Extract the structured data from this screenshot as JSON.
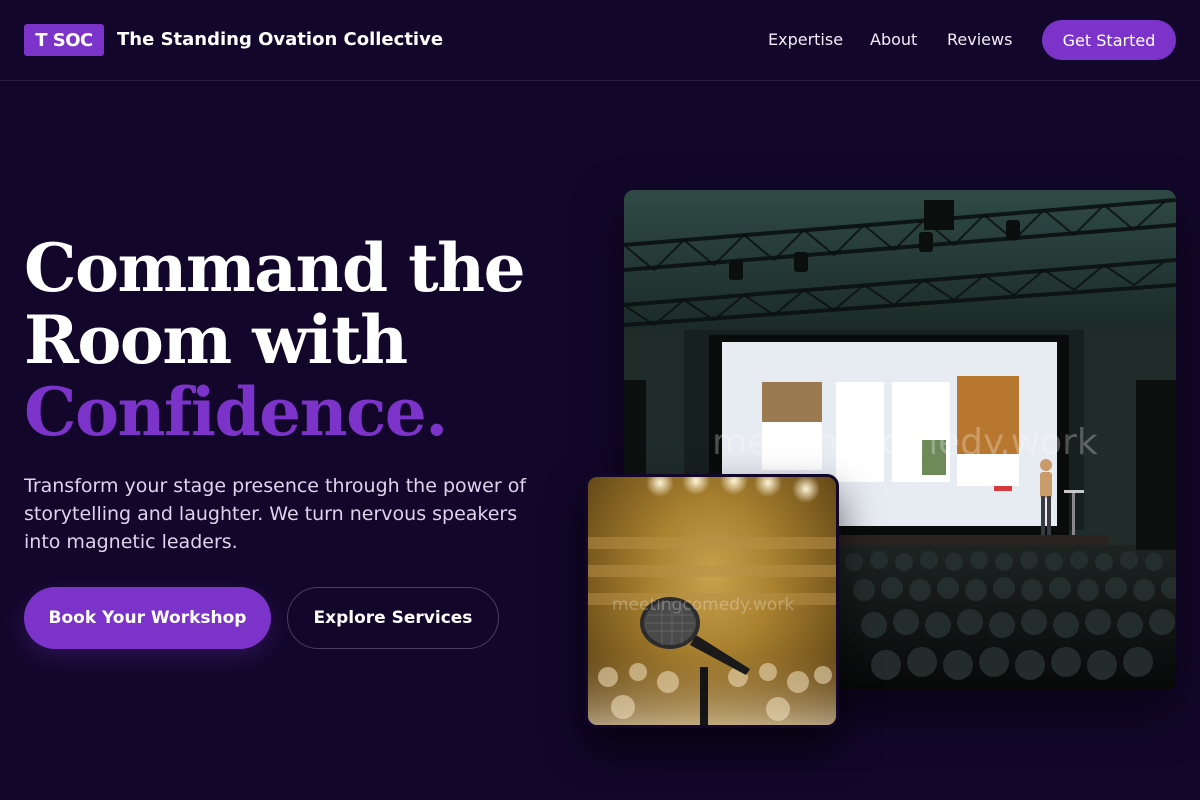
{
  "nav": {
    "logo_text": "T SOC",
    "brand_name": "The Standing Ovation Collective",
    "links": [
      {
        "label": "Expertise"
      },
      {
        "label": "About"
      },
      {
        "label": "Reviews"
      }
    ],
    "cta_label": "Get Started"
  },
  "hero": {
    "title_line1": "Command the",
    "title_line2": "Room with",
    "title_accent": "Confidence.",
    "description": "Transform your stage presence through the power of storytelling and laughter. We turn nervous speakers into magnetic leaders.",
    "primary_button": "Book Your Workshop",
    "secondary_button": "Explore Services"
  },
  "images": {
    "stage_watermark": "meetingcomedy.work",
    "mic_watermark": "meetingcomedy.work"
  },
  "colors": {
    "background": "#12072a",
    "accent": "#7c33c9"
  }
}
